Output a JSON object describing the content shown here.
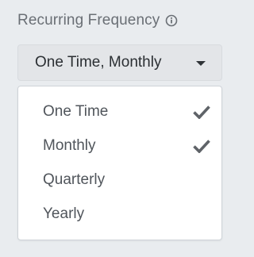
{
  "field": {
    "label": "Recurring Frequency",
    "info_icon": "info-circle-icon"
  },
  "select": {
    "value": "One Time, Monthly",
    "caret_icon": "caret-down-icon"
  },
  "options": [
    {
      "label": "One Time",
      "selected": true
    },
    {
      "label": "Monthly",
      "selected": true
    },
    {
      "label": "Quarterly",
      "selected": false
    },
    {
      "label": "Yearly",
      "selected": false
    }
  ],
  "colors": {
    "background": "#e9ecef",
    "select_bg": "#e3e5e8",
    "text": "#2b2f33",
    "muted_text": "#6a6f75",
    "check": "#5f6368"
  }
}
